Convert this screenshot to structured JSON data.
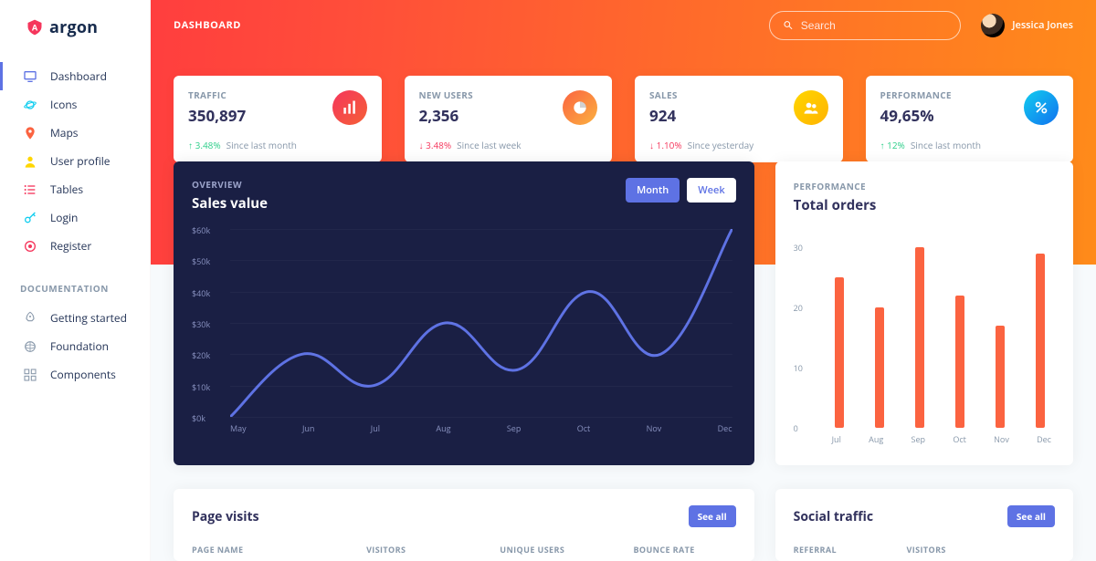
{
  "brand": "argon",
  "header": {
    "crumb": "DASHBOARD",
    "search_placeholder": "Search",
    "user_name": "Jessica Jones"
  },
  "sidebar": {
    "items": [
      {
        "label": "Dashboard",
        "icon": "tv-icon",
        "color": "#5e72e4",
        "active": true
      },
      {
        "label": "Icons",
        "icon": "planet-icon",
        "color": "#11cdef"
      },
      {
        "label": "Maps",
        "icon": "pin-icon",
        "color": "#fb6340"
      },
      {
        "label": "User profile",
        "icon": "user-icon",
        "color": "#ffd600"
      },
      {
        "label": "Tables",
        "icon": "list-icon",
        "color": "#f5365c"
      },
      {
        "label": "Login",
        "icon": "key-icon",
        "color": "#11cdef"
      },
      {
        "label": "Register",
        "icon": "circle-icon",
        "color": "#f5365c"
      }
    ],
    "docs_heading": "DOCUMENTATION",
    "docs": [
      {
        "label": "Getting started",
        "icon": "rocket-icon"
      },
      {
        "label": "Foundation",
        "icon": "globe-icon"
      },
      {
        "label": "Components",
        "icon": "grid-icon"
      }
    ]
  },
  "stats": [
    {
      "title": "TRAFFIC",
      "value": "350,897",
      "delta": "3.48%",
      "dir": "up",
      "period": "Since last month",
      "badge": "b-red",
      "icon": "bar-icon"
    },
    {
      "title": "NEW USERS",
      "value": "2,356",
      "delta": "3.48%",
      "dir": "down",
      "period": "Since last week",
      "badge": "b-orange",
      "icon": "pie-icon"
    },
    {
      "title": "SALES",
      "value": "924",
      "delta": "1.10%",
      "dir": "down",
      "period": "Since yesterday",
      "badge": "b-yellow",
      "icon": "users-icon"
    },
    {
      "title": "PERFORMANCE",
      "value": "49,65%",
      "delta": "12%",
      "dir": "up",
      "period": "Since last month",
      "badge": "b-cyan",
      "icon": "percent-icon"
    }
  ],
  "sales_chart": {
    "sub": "OVERVIEW",
    "title": "Sales value",
    "tabs": {
      "month": "Month",
      "week": "Week",
      "active": "month"
    }
  },
  "orders_chart": {
    "sub": "PERFORMANCE",
    "title": "Total orders"
  },
  "page_visits": {
    "title": "Page visits",
    "button": "See all",
    "columns": [
      "PAGE NAME",
      "VISITORS",
      "UNIQUE USERS",
      "BOUNCE RATE"
    ]
  },
  "social_traffic": {
    "title": "Social traffic",
    "button": "See all",
    "columns": [
      "REFERRAL",
      "VISITORS",
      ""
    ]
  },
  "chart_data": [
    {
      "type": "line",
      "title": "Sales value",
      "xlabel": "",
      "ylabel": "",
      "ylim": [
        0,
        60
      ],
      "y_unit": "$k",
      "categories": [
        "May",
        "Jun",
        "Jul",
        "Aug",
        "Sep",
        "Oct",
        "Nov",
        "Dec"
      ],
      "values": [
        0,
        20,
        10,
        30,
        15,
        40,
        20,
        60
      ]
    },
    {
      "type": "bar",
      "title": "Total orders",
      "xlabel": "",
      "ylabel": "",
      "ylim": [
        0,
        30
      ],
      "categories": [
        "Jul",
        "Aug",
        "Sep",
        "Oct",
        "Nov",
        "Dec"
      ],
      "values": [
        25,
        20,
        30,
        22,
        17,
        29
      ]
    }
  ]
}
